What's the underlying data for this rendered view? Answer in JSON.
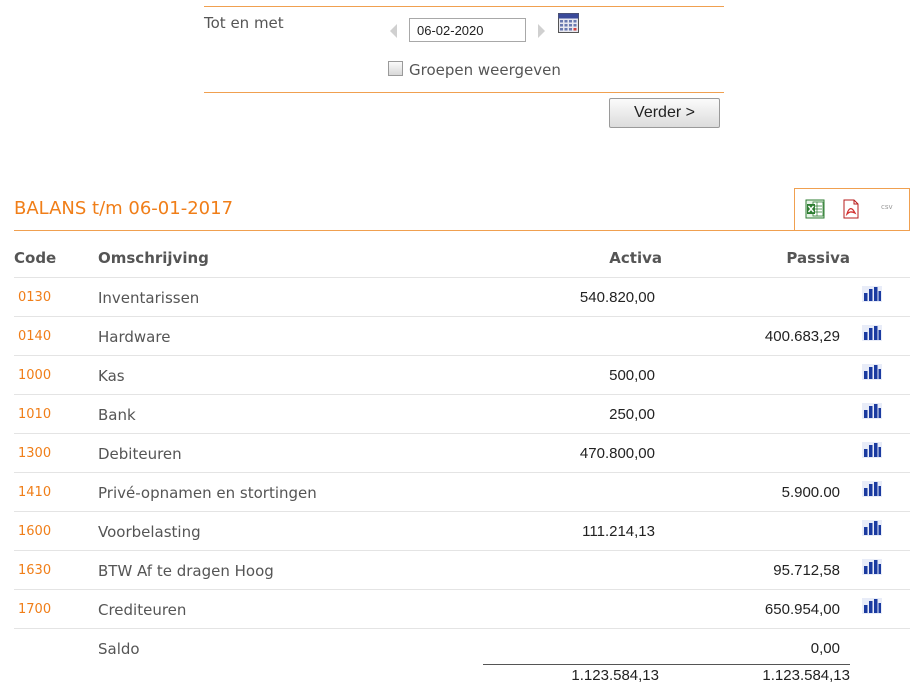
{
  "form": {
    "date_label": "Tot en met",
    "date_value": "06-02-2020",
    "groups_label": "Groepen weergeven",
    "groups_checked": false,
    "submit_label": "Verder >"
  },
  "report": {
    "title": "BALANS t/m 06-01-2017",
    "export": {
      "csv_label": "csv"
    },
    "columns": {
      "code": "Code",
      "description": "Omschrijving",
      "activa": "Activa",
      "passiva": "Passiva"
    },
    "rows": [
      {
        "code": "0130",
        "description": "Inventarissen",
        "activa": "540.820,00",
        "passiva": ""
      },
      {
        "code": "0140",
        "description": "Hardware",
        "activa": "",
        "passiva": "400.683,29"
      },
      {
        "code": "1000",
        "description": "Kas",
        "activa": "500,00",
        "passiva": ""
      },
      {
        "code": "1010",
        "description": "Bank",
        "activa": "250,00",
        "passiva": ""
      },
      {
        "code": "1300",
        "description": "Debiteuren",
        "activa": "470.800,00",
        "passiva": ""
      },
      {
        "code": "1410",
        "description": "Privé-opnamen en stortingen",
        "activa": "",
        "passiva": "5.900.00"
      },
      {
        "code": "1600",
        "description": "Voorbelasting",
        "activa": "111.214,13",
        "passiva": ""
      },
      {
        "code": "1630",
        "description": "BTW Af te dragen Hoog",
        "activa": "",
        "passiva": "95.712,58"
      },
      {
        "code": "1700",
        "description": "Crediteuren",
        "activa": "",
        "passiva": "650.954,00"
      }
    ],
    "saldo": {
      "label": "Saldo",
      "value": "0,00"
    },
    "totals": {
      "activa": "1.123.584,13",
      "passiva": "1.123.584,13"
    }
  },
  "colors": {
    "accent": "#f07e18",
    "accent_line": "#f0a050",
    "chart_icon": "#1a3aa0"
  }
}
